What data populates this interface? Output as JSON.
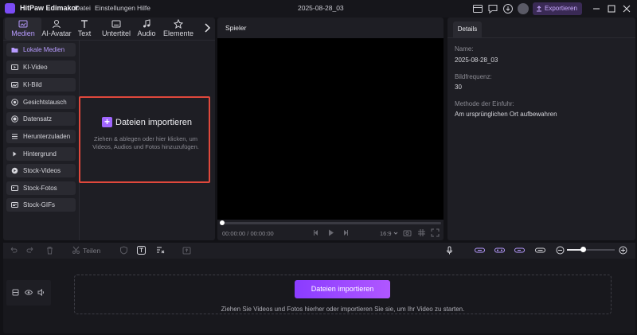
{
  "titlebar": {
    "app_name": "HitPaw Edimakor",
    "menu": [
      "Datei",
      "Einstellungen",
      "Hilfe"
    ],
    "project_title": "2025-08-28_03",
    "export_label": "Exportieren"
  },
  "toolbar": {
    "tabs": [
      {
        "label": "Medien",
        "icon": "media-icon",
        "active": true
      },
      {
        "label": "AI-Avatar",
        "icon": "avatar-icon"
      },
      {
        "label": "Text",
        "icon": "text-icon"
      },
      {
        "label": "Untertitel",
        "icon": "subtitle-icon"
      },
      {
        "label": "Audio",
        "icon": "audio-icon"
      },
      {
        "label": "Elemente",
        "icon": "elements-icon"
      }
    ]
  },
  "sidebar": {
    "items": [
      {
        "label": "Lokale Medien",
        "active": true
      },
      {
        "label": "KI-Video"
      },
      {
        "label": "KI-Bild"
      },
      {
        "label": "Gesichtstausch"
      },
      {
        "label": "Datensatz"
      },
      {
        "label": "Herunterzuladen"
      },
      {
        "label": "Hintergrund"
      },
      {
        "label": "Stock-Videos"
      },
      {
        "label": "Stock-Fotos"
      },
      {
        "label": "Stock-GIFs"
      }
    ]
  },
  "import_area": {
    "title": "Dateien importieren",
    "hint": "Ziehen & ablegen oder hier klicken, um Videos, Audios und Fotos hinzuzufügen."
  },
  "player": {
    "title": "Spieler",
    "current_time": "00:00:00",
    "separator": "/",
    "total_time": "00:00:00",
    "aspect_ratio": "16:9",
    "progress": 0
  },
  "details": {
    "tab": "Details",
    "fields": [
      {
        "label": "Name:",
        "value": "2025-08-28_03"
      },
      {
        "label": "Bildfrequenz:",
        "value": "30"
      },
      {
        "label": "Methode der Einfuhr:",
        "value": "Am ursprünglichen Ort aufbewahren"
      }
    ]
  },
  "timeline": {
    "split_label": "Teilen",
    "import_button": "Dateien importieren",
    "hint": "Ziehen Sie Videos und Fotos hierher oder importieren Sie sie, um Ihr Video zu starten.",
    "zoom_level": 0.3
  },
  "colors": {
    "accent": "#a066ff",
    "highlight_border": "#e0483c",
    "background": "#121216",
    "panel": "#1e1e24"
  }
}
